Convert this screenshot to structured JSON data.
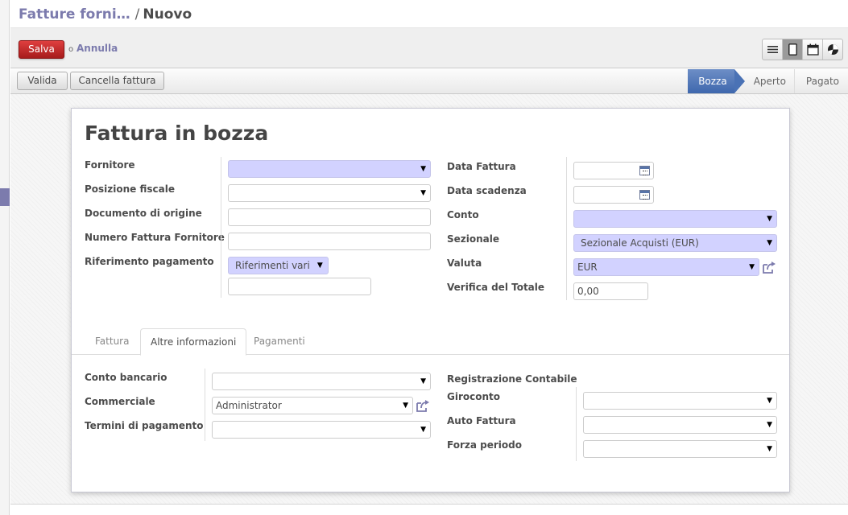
{
  "breadcrumb": {
    "parent": "Fatture forni…",
    "separator": "/",
    "current": "Nuovo"
  },
  "toolbar": {
    "save_label": "Salva",
    "or_label": "o",
    "discard_label": "Annulla"
  },
  "view_switcher": {
    "views": [
      "list-icon",
      "form-icon",
      "calendar-icon",
      "graph-icon"
    ],
    "active": "form-icon"
  },
  "actions": {
    "validate_label": "Valida",
    "cancel_invoice_label": "Cancella fattura"
  },
  "statusbar": {
    "stages": [
      "Bozza",
      "Aperto",
      "Pagato"
    ],
    "active": "Bozza"
  },
  "form": {
    "title": "Fattura in bozza",
    "left": {
      "supplier_label": "Fornitore",
      "supplier_value": "",
      "fiscal_position_label": "Posizione fiscale",
      "fiscal_position_value": "",
      "origin_label": "Documento di origine",
      "origin_value": "",
      "supplier_invoice_number_label": "Numero Fattura Fornitore",
      "supplier_invoice_number_value": "",
      "payment_reference_label": "Riferimento pagamento",
      "payment_reference_type": "Riferimenti vari",
      "payment_reference_value": ""
    },
    "right": {
      "invoice_date_label": "Data Fattura",
      "invoice_date_value": "",
      "due_date_label": "Data scadenza",
      "due_date_value": "",
      "account_label": "Conto",
      "account_value": "",
      "journal_label": "Sezionale",
      "journal_value": "Sezionale Acquisti (EUR)",
      "currency_label": "Valuta",
      "currency_value": "EUR",
      "check_total_label": "Verifica del Totale",
      "check_total_value": "0,00"
    }
  },
  "tabs": {
    "items": [
      "Fattura",
      "Altre informazioni",
      "Pagamenti"
    ],
    "active": "Altre informazioni"
  },
  "other_info": {
    "left": {
      "bank_account_label": "Conto bancario",
      "bank_account_value": "",
      "salesperson_label": "Commerciale",
      "salesperson_value": "Administrator",
      "payment_terms_label": "Termini di pagamento",
      "payment_terms_value": ""
    },
    "right": {
      "accounting_entry_label": "Registrazione Contabile",
      "move_label": "Giroconto",
      "move_value": "",
      "self_invoice_label": "Auto Fattura",
      "self_invoice_value": "",
      "force_period_label": "Forza periodo",
      "force_period_value": ""
    }
  },
  "colors": {
    "accent": "#7c7bad",
    "required_field": "#d2d2ff",
    "save_button": "#c82a2a",
    "status_active": "#4a72b5"
  }
}
